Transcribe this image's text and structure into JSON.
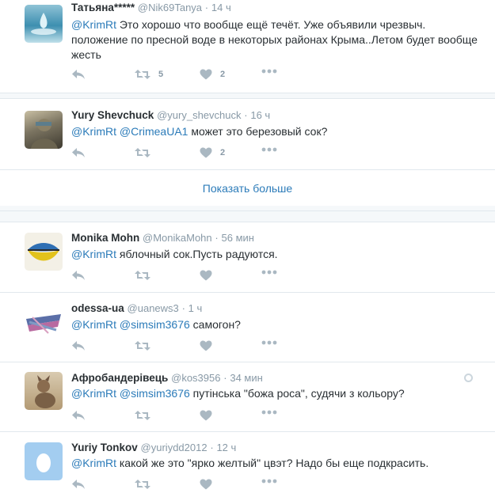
{
  "tweets": [
    {
      "name": "Татьяна*****",
      "handle": "@Nik69Tanya",
      "time": "14 ч",
      "mentions": "@KrimRt",
      "text": " Это хорошо что вообще ещё течёт. Уже объявили чрезвыч. положение по пресной воде в некоторых районах Крыма..Летом будет вообще жесть",
      "retweets": "5",
      "likes": "2"
    },
    {
      "name": "Yury Shevchuck",
      "handle": "@yury_shevchuck",
      "time": "16 ч",
      "mentions": "@KrimRt @CrimeaUA1",
      "text": " может это березовый сок?",
      "retweets": "",
      "likes": "2"
    },
    {
      "name": "Monika Mohn",
      "handle": "@MonikaMohn",
      "time": "56 мин",
      "mentions": "@KrimRt",
      "text": " яблочный сок.Пусть радуются.",
      "retweets": "",
      "likes": ""
    },
    {
      "name": "odessa-ua",
      "handle": "@uanews3",
      "time": "1 ч",
      "mentions": "@KrimRt @simsim3676",
      "text": " самогон?",
      "retweets": "",
      "likes": ""
    },
    {
      "name": "Афробандерівець",
      "handle": "@kos3956",
      "time": "34 мин",
      "mentions": "@KrimRt @simsim3676",
      "text": " путінська \"божа роса\", судячи з кольору?",
      "retweets": "",
      "likes": ""
    },
    {
      "name": "Yuriy Tonkov",
      "handle": "@yuriydd2012",
      "time": "12 ч",
      "mentions": "@KrimRt",
      "text": " какой же это \"ярко желтый\" цвэт? Надо бы еще подкрасить.",
      "retweets": "",
      "likes": ""
    }
  ],
  "show_more_label": "Показать больше",
  "dot": "·",
  "icons": [
    "reply-icon",
    "retweet-icon",
    "heart-icon",
    "more-icon",
    "globe-icon"
  ],
  "colors": {
    "link": "#2b7bb9",
    "muted": "#8899a6",
    "icon": "#aab8c2",
    "border": "#e1e8ed"
  }
}
